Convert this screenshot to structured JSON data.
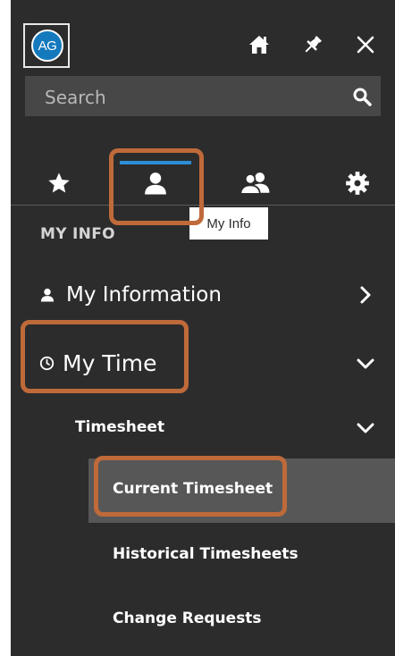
{
  "user": {
    "initials": "AG"
  },
  "search": {
    "placeholder": "Search"
  },
  "tabs": [
    {
      "name": "favorites"
    },
    {
      "name": "my-info"
    },
    {
      "name": "team"
    },
    {
      "name": "settings"
    }
  ],
  "tooltip": {
    "text": "My Info"
  },
  "section": {
    "title": "MY INFO"
  },
  "nav": {
    "my_information": "My Information",
    "my_time": "My Time",
    "timesheet": "Timesheet",
    "current_timesheet": "Current Timesheet",
    "historical_timesheets": "Historical Timesheets",
    "change_requests": "Change Requests"
  },
  "colors": {
    "panel": "#2c2c2c",
    "search_bg": "#474747",
    "accent": "#2b8fd6",
    "avatar": "#1479bd",
    "highlight": "#bf6a3a",
    "active_row": "#575757"
  }
}
